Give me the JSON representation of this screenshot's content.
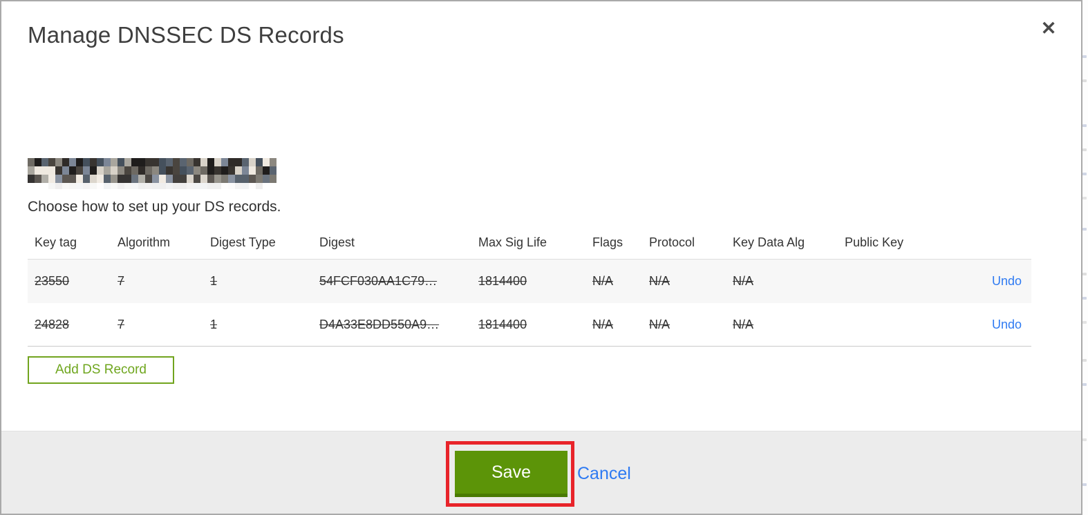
{
  "modal": {
    "title": "Manage DNSSEC DS Records",
    "close_label": "✕",
    "subtitle": "Choose how to set up your DS records.",
    "add_button_label": "Add DS Record",
    "save_label": "Save",
    "cancel_label": "Cancel"
  },
  "table": {
    "columns": [
      "Key tag",
      "Algorithm",
      "Digest Type",
      "Digest",
      "Max Sig Life",
      "Flags",
      "Protocol",
      "Key Data Alg",
      "Public Key"
    ],
    "rows": [
      {
        "key_tag": "23550",
        "algorithm": "7",
        "digest_type": "1",
        "digest": "54FCF030AA1C79…",
        "max_sig_life": "1814400",
        "flags": "N/A",
        "protocol": "N/A",
        "key_data_alg": "N/A",
        "public_key": "",
        "action": "Undo",
        "marked_deleted": true
      },
      {
        "key_tag": "24828",
        "algorithm": "7",
        "digest_type": "1",
        "digest": "D4A33E8DD550A9…",
        "max_sig_life": "1814400",
        "flags": "N/A",
        "protocol": "N/A",
        "key_data_alg": "N/A",
        "public_key": "",
        "action": "Undo",
        "marked_deleted": true
      }
    ]
  },
  "redacted_domain": {
    "note": "domain name obscured with pixel mosaic",
    "palette": [
      "#2f2b28",
      "#1f1d1c",
      "#4a453f",
      "#6e6a63",
      "#8c8880",
      "#7c8696",
      "#5a6470",
      "#a9a69e",
      "#efe9e0",
      "#d8d2c8",
      "#45505c",
      "#383430"
    ]
  },
  "colors": {
    "save_green": "#5c9408",
    "save_green_dark": "#4a7a04",
    "add_green": "#71a41e",
    "link_blue": "#2e7af2",
    "annotation_red": "#e8242a",
    "footer_gray": "#ececec",
    "row_gray": "#f7f7f7",
    "title_gray": "#3e3e3e"
  }
}
